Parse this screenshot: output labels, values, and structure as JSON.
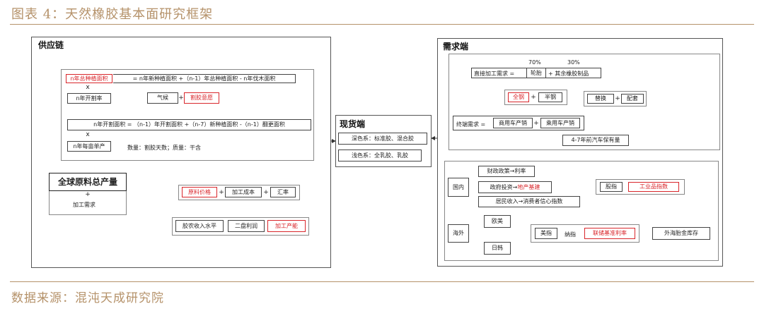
{
  "caption": "图表 4：天然橡胶基本面研究框架",
  "source": "数据来源：混沌天成研究院",
  "colors": {
    "accent": "#b5926a",
    "highlight": "#d9262b",
    "line": "#444444"
  },
  "supply": {
    "title": "供应链",
    "eq1": {
      "lhs": "n年总种植面积",
      "rest": "= n年新种植面积 +（n-1）年总种植面积 - n年伐木面积"
    },
    "times": "x",
    "tap_area": "n年开割率",
    "weather": "气候",
    "disease": "割胶意愿",
    "eq2": "n年开割面积 = （n-1）年开割面积 +（n-7）新种植面积 -（n-1）翻更面积",
    "yield": "n年每亩单产",
    "yield_note": "数量：割胶天数；质量：干含",
    "global_output": "全球原料总产量",
    "plus": "+",
    "processing_demand": "加工需求",
    "raw_price": "原料价格",
    "process_cost": "加工成本",
    "fx": "汇率",
    "farmer_income": "胶农收入水平",
    "secondary_profit": "二盘利润",
    "processing_yield": "加工产能"
  },
  "spot": {
    "title": "现货端",
    "dark": "深色系：标准胶、混合胶",
    "light": "浅色系：全乳胶、乳胶"
  },
  "demand": {
    "title": "需求端",
    "pct_tire": "70%",
    "pct_other": "30%",
    "direct": "直接加工需求 =",
    "tire": "轮胎",
    "other": "+ 其余橡胶制品",
    "allsteel": "全钢",
    "halfsteel": "半钢",
    "replace": "替换",
    "oem": "配套",
    "terminal": "终端需求 =",
    "commercial": "商用车产销",
    "passenger": "乘用车产销",
    "fleet": "4-7年前汽车保有量",
    "domestic": "国内",
    "fiscal": "财政政策→利率",
    "gov_invest": "政府投资→",
    "infra": "地产基建",
    "consumer": "居民收入→消费者信心指数",
    "stock_index": "股指",
    "industrial_index": "工业品指数",
    "overseas": "海外",
    "eu_us": "欧美",
    "japan_korea": "日韩",
    "us_index": "美指",
    "nasdaq": "纳指",
    "fed_rate": "联储基准利率",
    "foreign_inventory": "外海胎金库存"
  }
}
